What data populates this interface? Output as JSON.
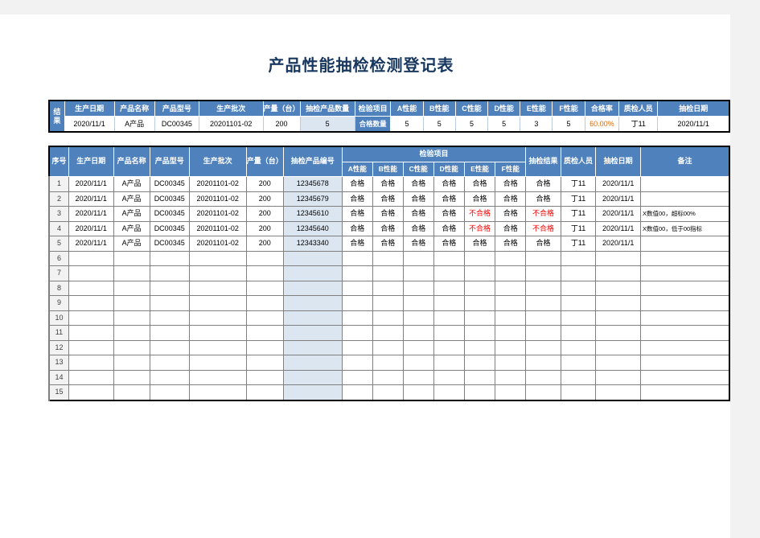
{
  "document": {
    "title": "产品性能抽检检测登记表"
  },
  "summary": {
    "row_label": "结果",
    "headers": [
      "生产日期",
      "产品名称",
      "产品型号",
      "生产批次",
      "产量（台）",
      "抽检产品数量",
      "检验项目",
      "A性能",
      "B性能",
      "C性能",
      "D性能",
      "E性能",
      "F性能",
      "合格率",
      "质检人员",
      "抽检日期"
    ],
    "values": {
      "production_date": "2020/11/1",
      "product_name": "A产品",
      "product_model": "DC00345",
      "production_batch": "20201101-02",
      "output": "200",
      "sample_count": "5",
      "item_label": "合格数量",
      "a": "5",
      "b": "5",
      "c": "5",
      "d": "5",
      "e": "3",
      "f": "5",
      "pass_rate": "60.00%",
      "inspector": "丁11",
      "sample_date": "2020/11/1"
    }
  },
  "main_table": {
    "headers": {
      "index": "序号",
      "production_date": "生产日期",
      "product_name": "产品名称",
      "product_model": "产品型号",
      "production_batch": "生产批次",
      "output": "产量（台）",
      "product_no": "抽检产品编号",
      "inspection_group": "检验项目",
      "a": "A性能",
      "b": "B性能",
      "c": "C性能",
      "d": "D性能",
      "e": "E性能",
      "f": "F性能",
      "result": "抽检结果",
      "inspector": "质检人员",
      "sample_date": "抽检日期",
      "remark": "备注"
    },
    "rows": [
      {
        "index": "1",
        "production_date": "2020/11/1",
        "product_name": "A产品",
        "product_model": "DC00345",
        "production_batch": "20201101-02",
        "output": "200",
        "product_no": "12345678",
        "a": "合格",
        "b": "合格",
        "c": "合格",
        "d": "合格",
        "e": "合格",
        "f": "合格",
        "result": "合格",
        "inspector": "丁11",
        "sample_date": "2020/11/1",
        "remark": ""
      },
      {
        "index": "2",
        "production_date": "2020/11/1",
        "product_name": "A产品",
        "product_model": "DC00345",
        "production_batch": "20201101-02",
        "output": "200",
        "product_no": "12345679",
        "a": "合格",
        "b": "合格",
        "c": "合格",
        "d": "合格",
        "e": "合格",
        "f": "合格",
        "result": "合格",
        "inspector": "丁11",
        "sample_date": "2020/11/1",
        "remark": ""
      },
      {
        "index": "3",
        "production_date": "2020/11/1",
        "product_name": "A产品",
        "product_model": "DC00345",
        "production_batch": "20201101-02",
        "output": "200",
        "product_no": "12345610",
        "a": "合格",
        "b": "合格",
        "c": "合格",
        "d": "合格",
        "e": "不合格",
        "f": "合格",
        "result": "不合格",
        "inspector": "丁11",
        "sample_date": "2020/11/1",
        "remark": "X数值00，超标00%"
      },
      {
        "index": "4",
        "production_date": "2020/11/1",
        "product_name": "A产品",
        "product_model": "DC00345",
        "production_batch": "20201101-02",
        "output": "200",
        "product_no": "12345640",
        "a": "合格",
        "b": "合格",
        "c": "合格",
        "d": "合格",
        "e": "不合格",
        "f": "合格",
        "result": "不合格",
        "inspector": "丁11",
        "sample_date": "2020/11/1",
        "remark": "X数值00，低于00指标"
      },
      {
        "index": "5",
        "production_date": "2020/11/1",
        "product_name": "A产品",
        "product_model": "DC00345",
        "production_batch": "20201101-02",
        "output": "200",
        "product_no": "12343340",
        "a": "合格",
        "b": "合格",
        "c": "合格",
        "d": "合格",
        "e": "合格",
        "f": "合格",
        "result": "合格",
        "inspector": "丁11",
        "sample_date": "2020/11/1",
        "remark": ""
      }
    ],
    "empty_row_indexes": [
      "6",
      "7",
      "8",
      "9",
      "10",
      "11",
      "12",
      "13",
      "14",
      "15"
    ]
  },
  "colors": {
    "header_blue": "#4f81bd",
    "fill_light_blue": "#dce6f1",
    "title_text": "#17375e",
    "fail_red": "#ff0000",
    "rate_orange": "#e46c0a",
    "index_gray": "#f2f2f2"
  }
}
